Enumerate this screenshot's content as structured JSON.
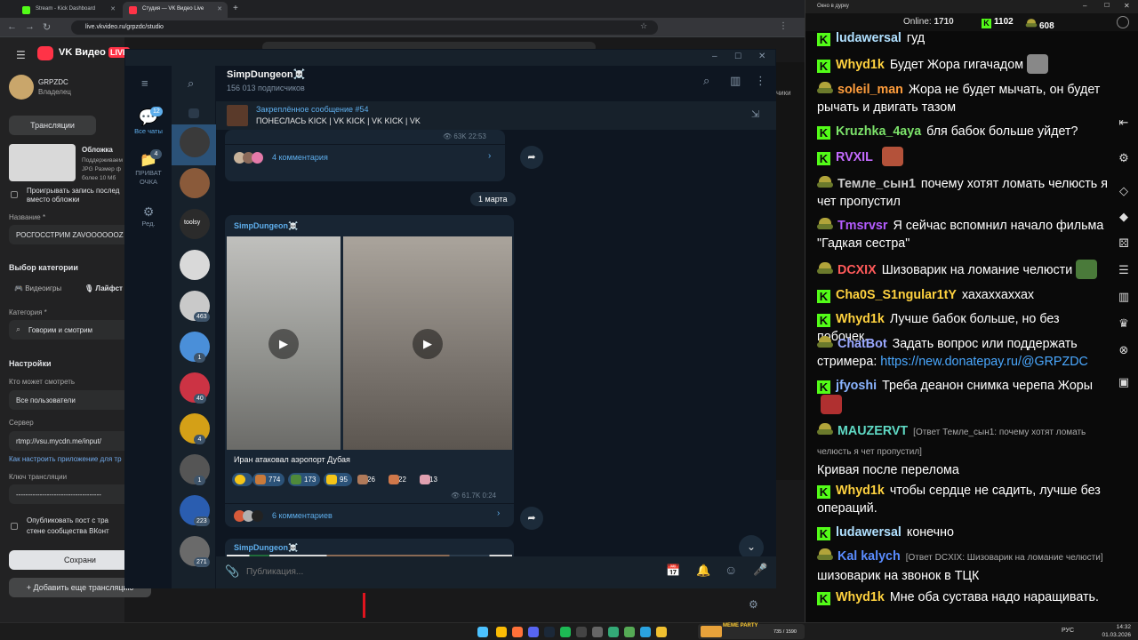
{
  "browser": {
    "tabs": [
      {
        "title": "Stream - Kick Dashboard",
        "color": "#53fc18"
      },
      {
        "title": "Студия — VK Видео Live",
        "color": "#ff3347"
      }
    ],
    "new_tab": "+",
    "url": "live.vkvideo.ru/grpzdc/studio"
  },
  "vk": {
    "logo": "VK Видео",
    "logo_badge": "LIVE",
    "channel": "GRPZDC",
    "role": "Владелец",
    "tab_broadcasts": "Трансляции",
    "cover_title": "Обложка",
    "cover_hint1": "Поддерживаем",
    "cover_hint2": "JPG Размер ф",
    "cover_hint3": "более 10 Мб",
    "play_record": "Проигрывать запись послед",
    "play_record2": "вместо обложки",
    "name_label": "Название *",
    "name_value": "РОСГОССТРИМ ZAVOOOOOOZ",
    "category_choice": "Выбор категории",
    "cat_games": "Видеоигры",
    "cat_life": "Лайфст",
    "category_label": "Категория *",
    "category_value": "Говорим и смотрим",
    "settings": "Настройки",
    "who_watch": "Кто может смотреть",
    "who_value": "Все пользователи",
    "server": "Сервер",
    "server_value": "rtmp://vsu.mycdn.me/input/",
    "howto": "Как настроить приложение для тр",
    "key_label": "Ключ трансляции",
    "key_value": "------------------------------------",
    "publish1": "Опубликовать пост с тра",
    "publish2": "стене сообщества ВКонт",
    "save": "Сохрани",
    "add_more": "Добавить еще трансляцию",
    "right_cut": "чики"
  },
  "tg": {
    "channel_name": "SimpDungeon☠️",
    "subscribers": "156 013 подписчиков",
    "folders": [
      {
        "label": "Все чаты",
        "badge": "12"
      },
      {
        "label": "ПРИВАТ ОЧКА",
        "badge": "4"
      },
      {
        "label": "Ред.",
        "badge": ""
      }
    ],
    "chats": [
      {
        "badge": "",
        "color": "#3a3a3a"
      },
      {
        "badge": "",
        "color": "#8a5a3a"
      },
      {
        "badge": "",
        "color": "#2b2b2b",
        "text": "toolsy"
      },
      {
        "badge": "",
        "color": "#d9d9d9"
      },
      {
        "badge": "463",
        "color": "#c9c9c9"
      },
      {
        "badge": "1",
        "color": "#4a8fd9"
      },
      {
        "badge": "40",
        "color": "#cc3344"
      },
      {
        "badge": "4",
        "color": "#d4a017"
      },
      {
        "badge": "1",
        "color": "#555555"
      },
      {
        "badge": "223",
        "color": "#2a5db0"
      },
      {
        "badge": "271",
        "color": "#6a6a6a"
      }
    ],
    "pinned_title": "Закреплённое сообщение #54",
    "pinned_text": "ПОНЕСЛАСЬ  KICK | VK KICK | VK KICK | VK",
    "top_views": "63K",
    "top_time": "22:53",
    "top_comments": "4 комментария",
    "date": "1 марта",
    "post_author": "SimpDungeon☠️",
    "post_caption": "Иран атаковал аэропорт Дубая",
    "reactions": [
      {
        "count": "",
        "icon": "star",
        "color": "#f5c518"
      },
      {
        "count": "774",
        "icon": "emote",
        "color": "#c97a3a"
      },
      {
        "count": "173",
        "icon": "emote",
        "color": "#4f8a3a"
      },
      {
        "count": "95",
        "icon": "thumbs-up",
        "color": "#f5c518"
      },
      {
        "count": "26",
        "icon": "emote",
        "color": "#b07a5a"
      },
      {
        "count": "22",
        "icon": "emote",
        "color": "#d0784a"
      },
      {
        "count": "13",
        "icon": "emote",
        "color": "#e0a0b0"
      }
    ],
    "post_views": "61.7K",
    "post_time": "0:24",
    "post_comments": "6 комментариев",
    "next_author": "SimpDungeon☠️",
    "input_placeholder": "Публикация..."
  },
  "chat": {
    "window_title": "Окно в дурку",
    "online_label": "Online:",
    "online_value": "1710",
    "kick_count": "1102",
    "vk_count": "608",
    "messages": [
      {
        "platform": "kick",
        "user": "ludawersal",
        "color": "#b0e0ff",
        "text": "гуд"
      },
      {
        "platform": "kick",
        "user": "Whyd1k",
        "color": "#ffd23f",
        "text": "Будет Жора гигачадом",
        "emote": "#888"
      },
      {
        "platform": "vk",
        "user": "soleil_man",
        "color": "#ff9d3c",
        "text": "Жора не будет мычать, он будет рычать и двигать тазом"
      },
      {
        "platform": "kick",
        "user": "Kruzhka_4aya",
        "color": "#7ce26a",
        "text": "бля бабок больше уйдет?"
      },
      {
        "platform": "kick",
        "user": "RVXIL",
        "color": "#c46bff",
        "text": "",
        "emote": "#b4523a"
      },
      {
        "platform": "vk",
        "user": "Темле_сын1",
        "color": "#c8c8c8",
        "text": "почему хотят ломать челюсть я чет пропустил"
      },
      {
        "platform": "vk",
        "user": "Tmsrvsr",
        "color": "#b45cff",
        "text": "Я сейчас вспомнил начало фильма \"Гадкая сестра\""
      },
      {
        "platform": "vk",
        "user": "DCXIX",
        "color": "#ff5a5a",
        "text": "Шизоварик на ломание челюсти",
        "emote": "#4a7a3a"
      },
      {
        "platform": "kick",
        "user": "Cha0S_S1ngular1tY",
        "color": "#ffd23f",
        "text": "хахаххаххах"
      },
      {
        "platform": "kick",
        "user": "Whyd1k",
        "color": "#ffd23f",
        "text": "Лучше бабок больше, но без побочек."
      },
      {
        "platform": "vk",
        "user": "ChatBot",
        "color": "#9aa8ff",
        "text": "Задать вопрос или поддержать стримера:",
        "link": "https://new.donatepay.ru/@GRPZDC"
      },
      {
        "platform": "kick",
        "user": "jfyoshi",
        "color": "#8ab4ff",
        "text": "Треба деанон снимка черепа Жоры",
        "emote": "#b03030"
      },
      {
        "platform": "vk",
        "user": "MAUZERVT",
        "color": "#5fd9c4",
        "reply": "[Ответ Темле_сын1: почему хотят ломать челюсть я чет пропустил]",
        "text": "Кривая после перелома"
      },
      {
        "platform": "kick",
        "user": "Whyd1k",
        "color": "#ffd23f",
        "text": "чтобы сердце не садить, лучше без операций."
      },
      {
        "platform": "kick",
        "user": "ludawersal",
        "color": "#b0e0ff",
        "text": "конечно"
      },
      {
        "platform": "vk",
        "user": "Kal kalych",
        "color": "#5a8cff",
        "reply": "[Ответ DCXIX: Шизоварик на ломание челюсти]",
        "text": "шизоварик на звонок в ТЦК"
      },
      {
        "platform": "kick",
        "user": "Whyd1k",
        "color": "#ffd23f",
        "text": "Мне оба сустава надо наращивать."
      }
    ]
  },
  "taskbar": {
    "lang": "РУС",
    "time": "14:32",
    "date": "01.03.2026",
    "media_label": "MEME PARTY",
    "media_counter": "735 / 1590"
  }
}
